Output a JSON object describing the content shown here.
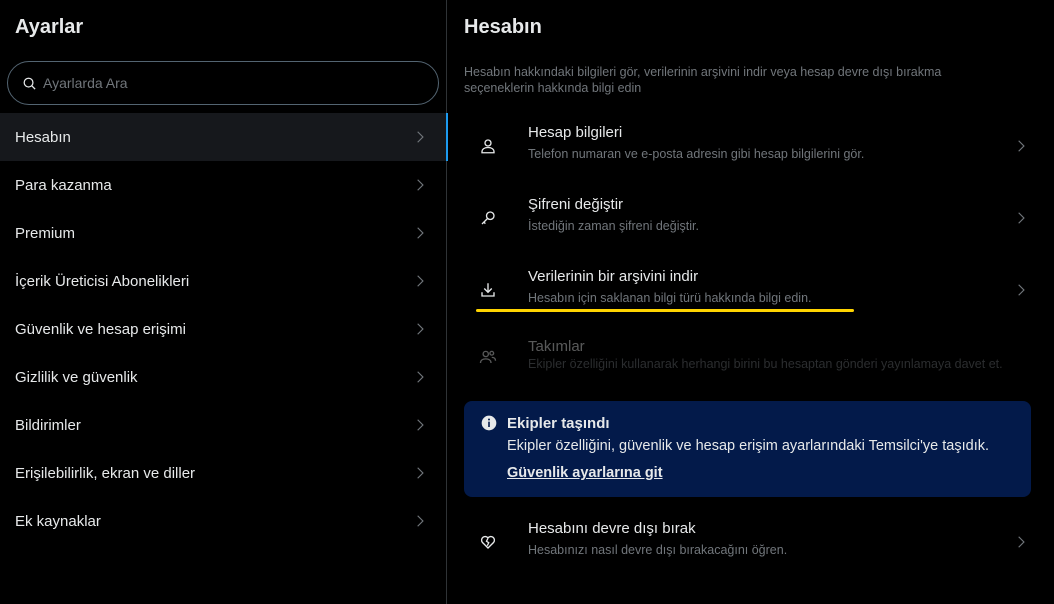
{
  "colors": {
    "background": "#000000",
    "active_item_bg": "#16181c",
    "accent": "#1d9bf0",
    "highlight": "#ffd400",
    "notice_bg": "#031a4a",
    "muted_text": "#71767b"
  },
  "sidebar": {
    "title": "Ayarlar",
    "search_placeholder": "Ayarlarda Ara",
    "items": [
      {
        "label": "Hesabın",
        "active": true
      },
      {
        "label": "Para kazanma"
      },
      {
        "label": "Premium"
      },
      {
        "label": "İçerik Üreticisi Abonelikleri"
      },
      {
        "label": "Güvenlik ve hesap erişimi"
      },
      {
        "label": "Gizlilik ve güvenlik"
      },
      {
        "label": "Bildirimler"
      },
      {
        "label": "Erişilebilirlik, ekran ve diller"
      },
      {
        "label": "Ek kaynaklar"
      }
    ]
  },
  "main": {
    "title": "Hesabın",
    "description": "Hesabın hakkındaki bilgileri gör, verilerinin arşivini indir veya hesap devre dışı bırakma seçeneklerin hakkında bilgi edin",
    "rows": [
      {
        "icon": "person-icon",
        "title": "Hesap bilgileri",
        "subtitle": "Telefon numaran ve e-posta adresin gibi hesap bilgilerini gör."
      },
      {
        "icon": "key-icon",
        "title": "Şifreni değiştir",
        "subtitle": "İstediğin zaman şifreni değiştir."
      },
      {
        "icon": "download-icon",
        "title": "Verilerinin bir arşivini indir",
        "subtitle": "Hesabın için saklanan bilgi türü hakkında bilgi edin."
      },
      {
        "icon": "team-icon",
        "title": "Takımlar",
        "subtitle": "Ekipler özelliğini kullanarak herhangi birini bu hesaptan gönderi yayınlamaya davet et.",
        "disabled": true
      },
      {
        "icon": "broken-heart-icon",
        "title": "Hesabını devre dışı bırak",
        "subtitle": "Hesabınızı nasıl devre dışı bırakacağını öğren."
      }
    ],
    "notice": {
      "title": "Ekipler taşındı",
      "body": "Ekipler özelliğini, güvenlik ve hesap erişim ayarlarındaki Temsilci'ye taşıdık.",
      "link": "Güvenlik ayarlarına git"
    }
  }
}
